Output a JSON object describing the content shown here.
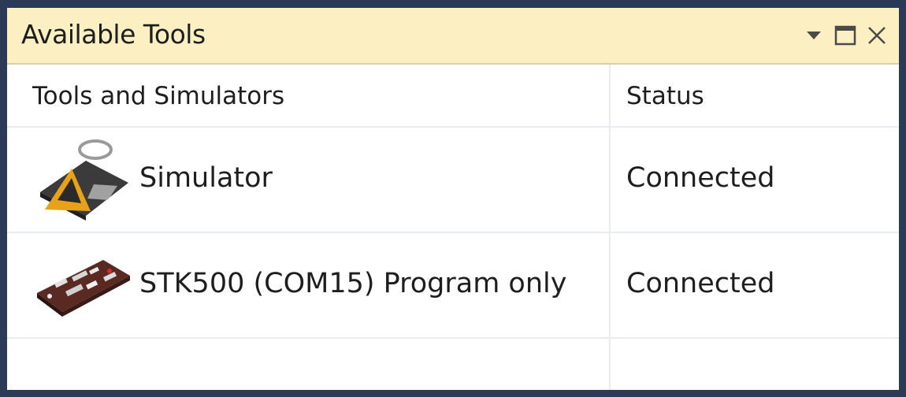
{
  "window": {
    "title": "Available Tools",
    "controls": {
      "dropdown_icon": "chevron-down-icon",
      "maximize_icon": "maximize-icon",
      "close_icon": "close-icon"
    }
  },
  "table": {
    "columns": [
      "Tools and Simulators",
      "Status"
    ],
    "rows": [
      {
        "icon": "simulator-icon",
        "name": "Simulator",
        "status": "Connected"
      },
      {
        "icon": "stk500-board-icon",
        "name": "STK500 (COM15) Program only",
        "status": "Connected"
      }
    ]
  },
  "colors": {
    "title_bar_bg": "#fcefc2",
    "window_border": "#2b3b57",
    "grid_line": "#e8ebf0",
    "text": "#1e1e1e"
  }
}
